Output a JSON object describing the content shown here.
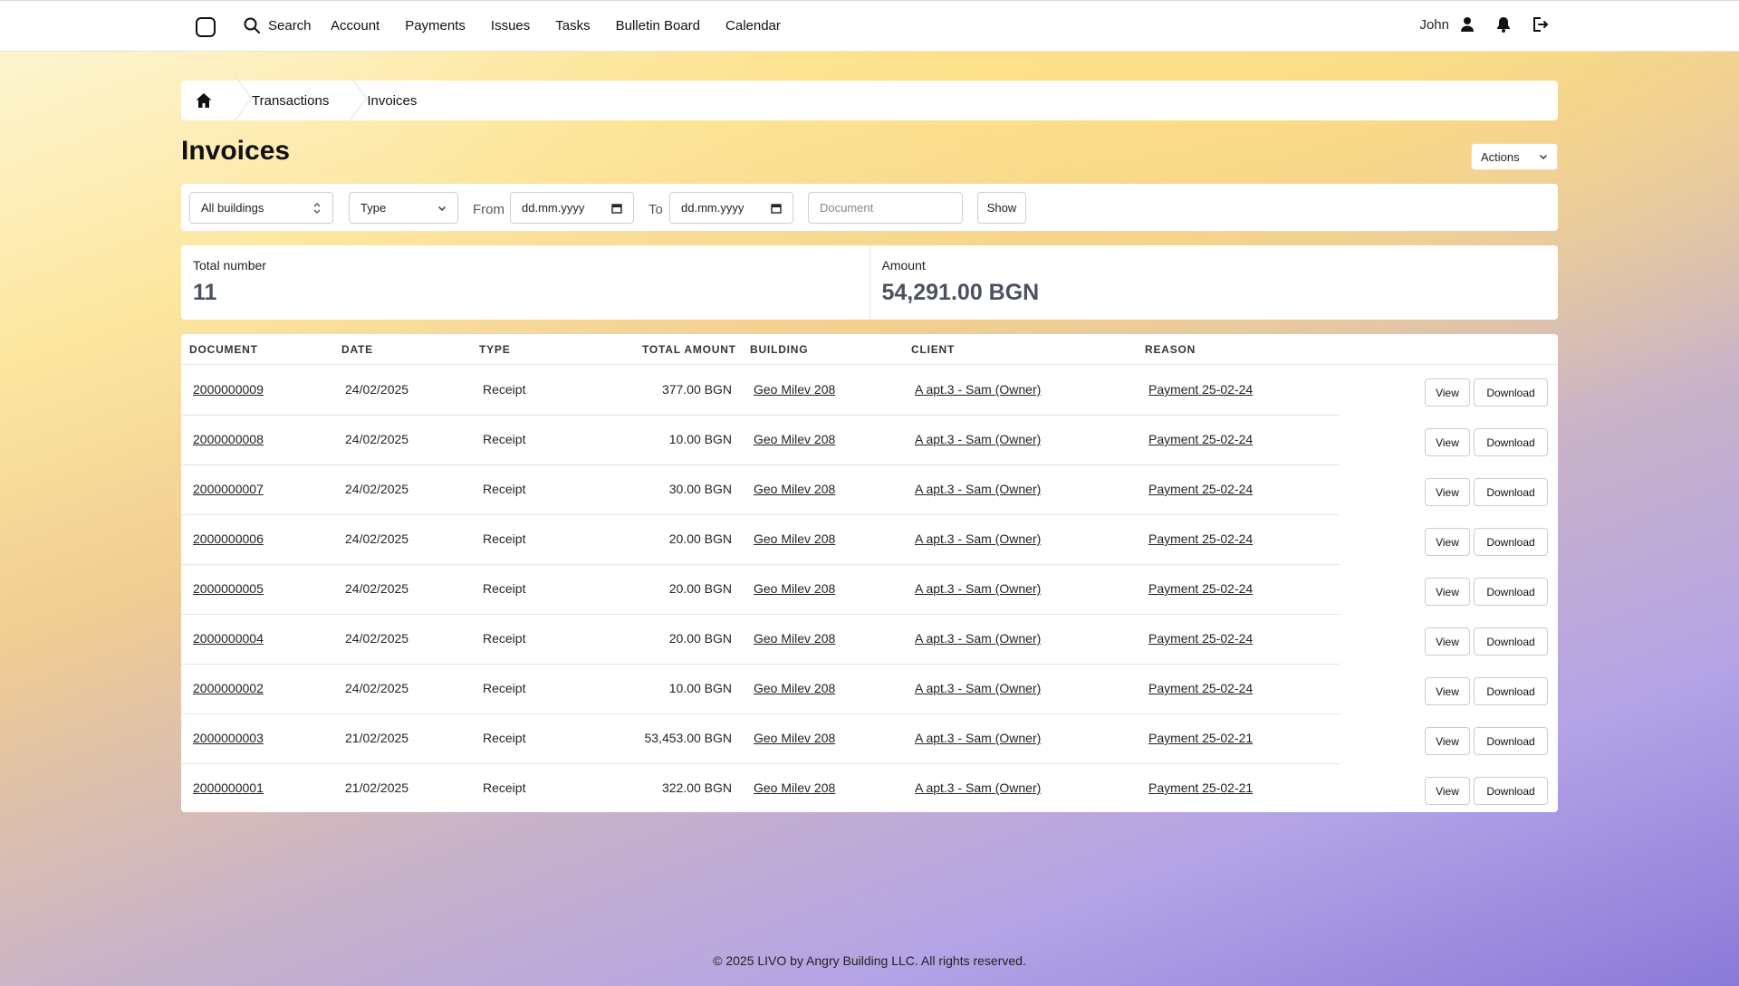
{
  "nav": {
    "search": "Search",
    "items": [
      "Account",
      "Payments",
      "Issues",
      "Tasks",
      "Bulletin Board",
      "Calendar"
    ],
    "user": "John"
  },
  "breadcrumb": [
    "Transactions",
    "Invoices"
  ],
  "page_title": "Invoices",
  "actions_label": "Actions",
  "filters": {
    "building": "All buildings",
    "type": "Type",
    "from_label": "From",
    "from_placeholder": "dd.mm.yyyy",
    "to_label": "To",
    "to_placeholder": "dd.mm.yyyy",
    "document_placeholder": "Document",
    "show_label": "Show"
  },
  "stats": {
    "total_label": "Total number",
    "total_value": "11",
    "amount_label": "Amount",
    "amount_value": "54,291.00 BGN"
  },
  "table": {
    "headers": [
      "DOCUMENT",
      "DATE",
      "TYPE",
      "TOTAL AMOUNT",
      "BUILDING",
      "CLIENT",
      "REASON"
    ],
    "view_label": "View",
    "download_label": "Download",
    "rows": [
      {
        "document": "2000000009",
        "date": "24/02/2025",
        "type": "Receipt",
        "amount": "377.00 BGN",
        "building": "Geo Milev 208",
        "client": "A apt.3 - Sam (Owner)",
        "reason": "Payment 25-02-24"
      },
      {
        "document": "2000000008",
        "date": "24/02/2025",
        "type": "Receipt",
        "amount": "10.00 BGN",
        "building": "Geo Milev 208",
        "client": "A apt.3 - Sam (Owner)",
        "reason": "Payment 25-02-24"
      },
      {
        "document": "2000000007",
        "date": "24/02/2025",
        "type": "Receipt",
        "amount": "30.00 BGN",
        "building": "Geo Milev 208",
        "client": "A apt.3 - Sam (Owner)",
        "reason": "Payment 25-02-24"
      },
      {
        "document": "2000000006",
        "date": "24/02/2025",
        "type": "Receipt",
        "amount": "20.00 BGN",
        "building": "Geo Milev 208",
        "client": "A apt.3 - Sam (Owner)",
        "reason": "Payment 25-02-24"
      },
      {
        "document": "2000000005",
        "date": "24/02/2025",
        "type": "Receipt",
        "amount": "20.00 BGN",
        "building": "Geo Milev 208",
        "client": "A apt.3 - Sam (Owner)",
        "reason": "Payment 25-02-24"
      },
      {
        "document": "2000000004",
        "date": "24/02/2025",
        "type": "Receipt",
        "amount": "20.00 BGN",
        "building": "Geo Milev 208",
        "client": "A apt.3 - Sam (Owner)",
        "reason": "Payment 25-02-24"
      },
      {
        "document": "2000000002",
        "date": "24/02/2025",
        "type": "Receipt",
        "amount": "10.00 BGN",
        "building": "Geo Milev 208",
        "client": "A apt.3 - Sam (Owner)",
        "reason": "Payment 25-02-24"
      },
      {
        "document": "2000000003",
        "date": "21/02/2025",
        "type": "Receipt",
        "amount": "53,453.00 BGN",
        "building": "Geo Milev 208",
        "client": "A apt.3 - Sam (Owner)",
        "reason": "Payment 25-02-21"
      },
      {
        "document": "2000000001",
        "date": "21/02/2025",
        "type": "Receipt",
        "amount": "322.00 BGN",
        "building": "Geo Milev 208",
        "client": "A apt.3 - Sam (Owner)",
        "reason": "Payment 25-02-21"
      }
    ]
  },
  "footer": "© 2025 LIVO by Angry Building LLC. All rights reserved."
}
